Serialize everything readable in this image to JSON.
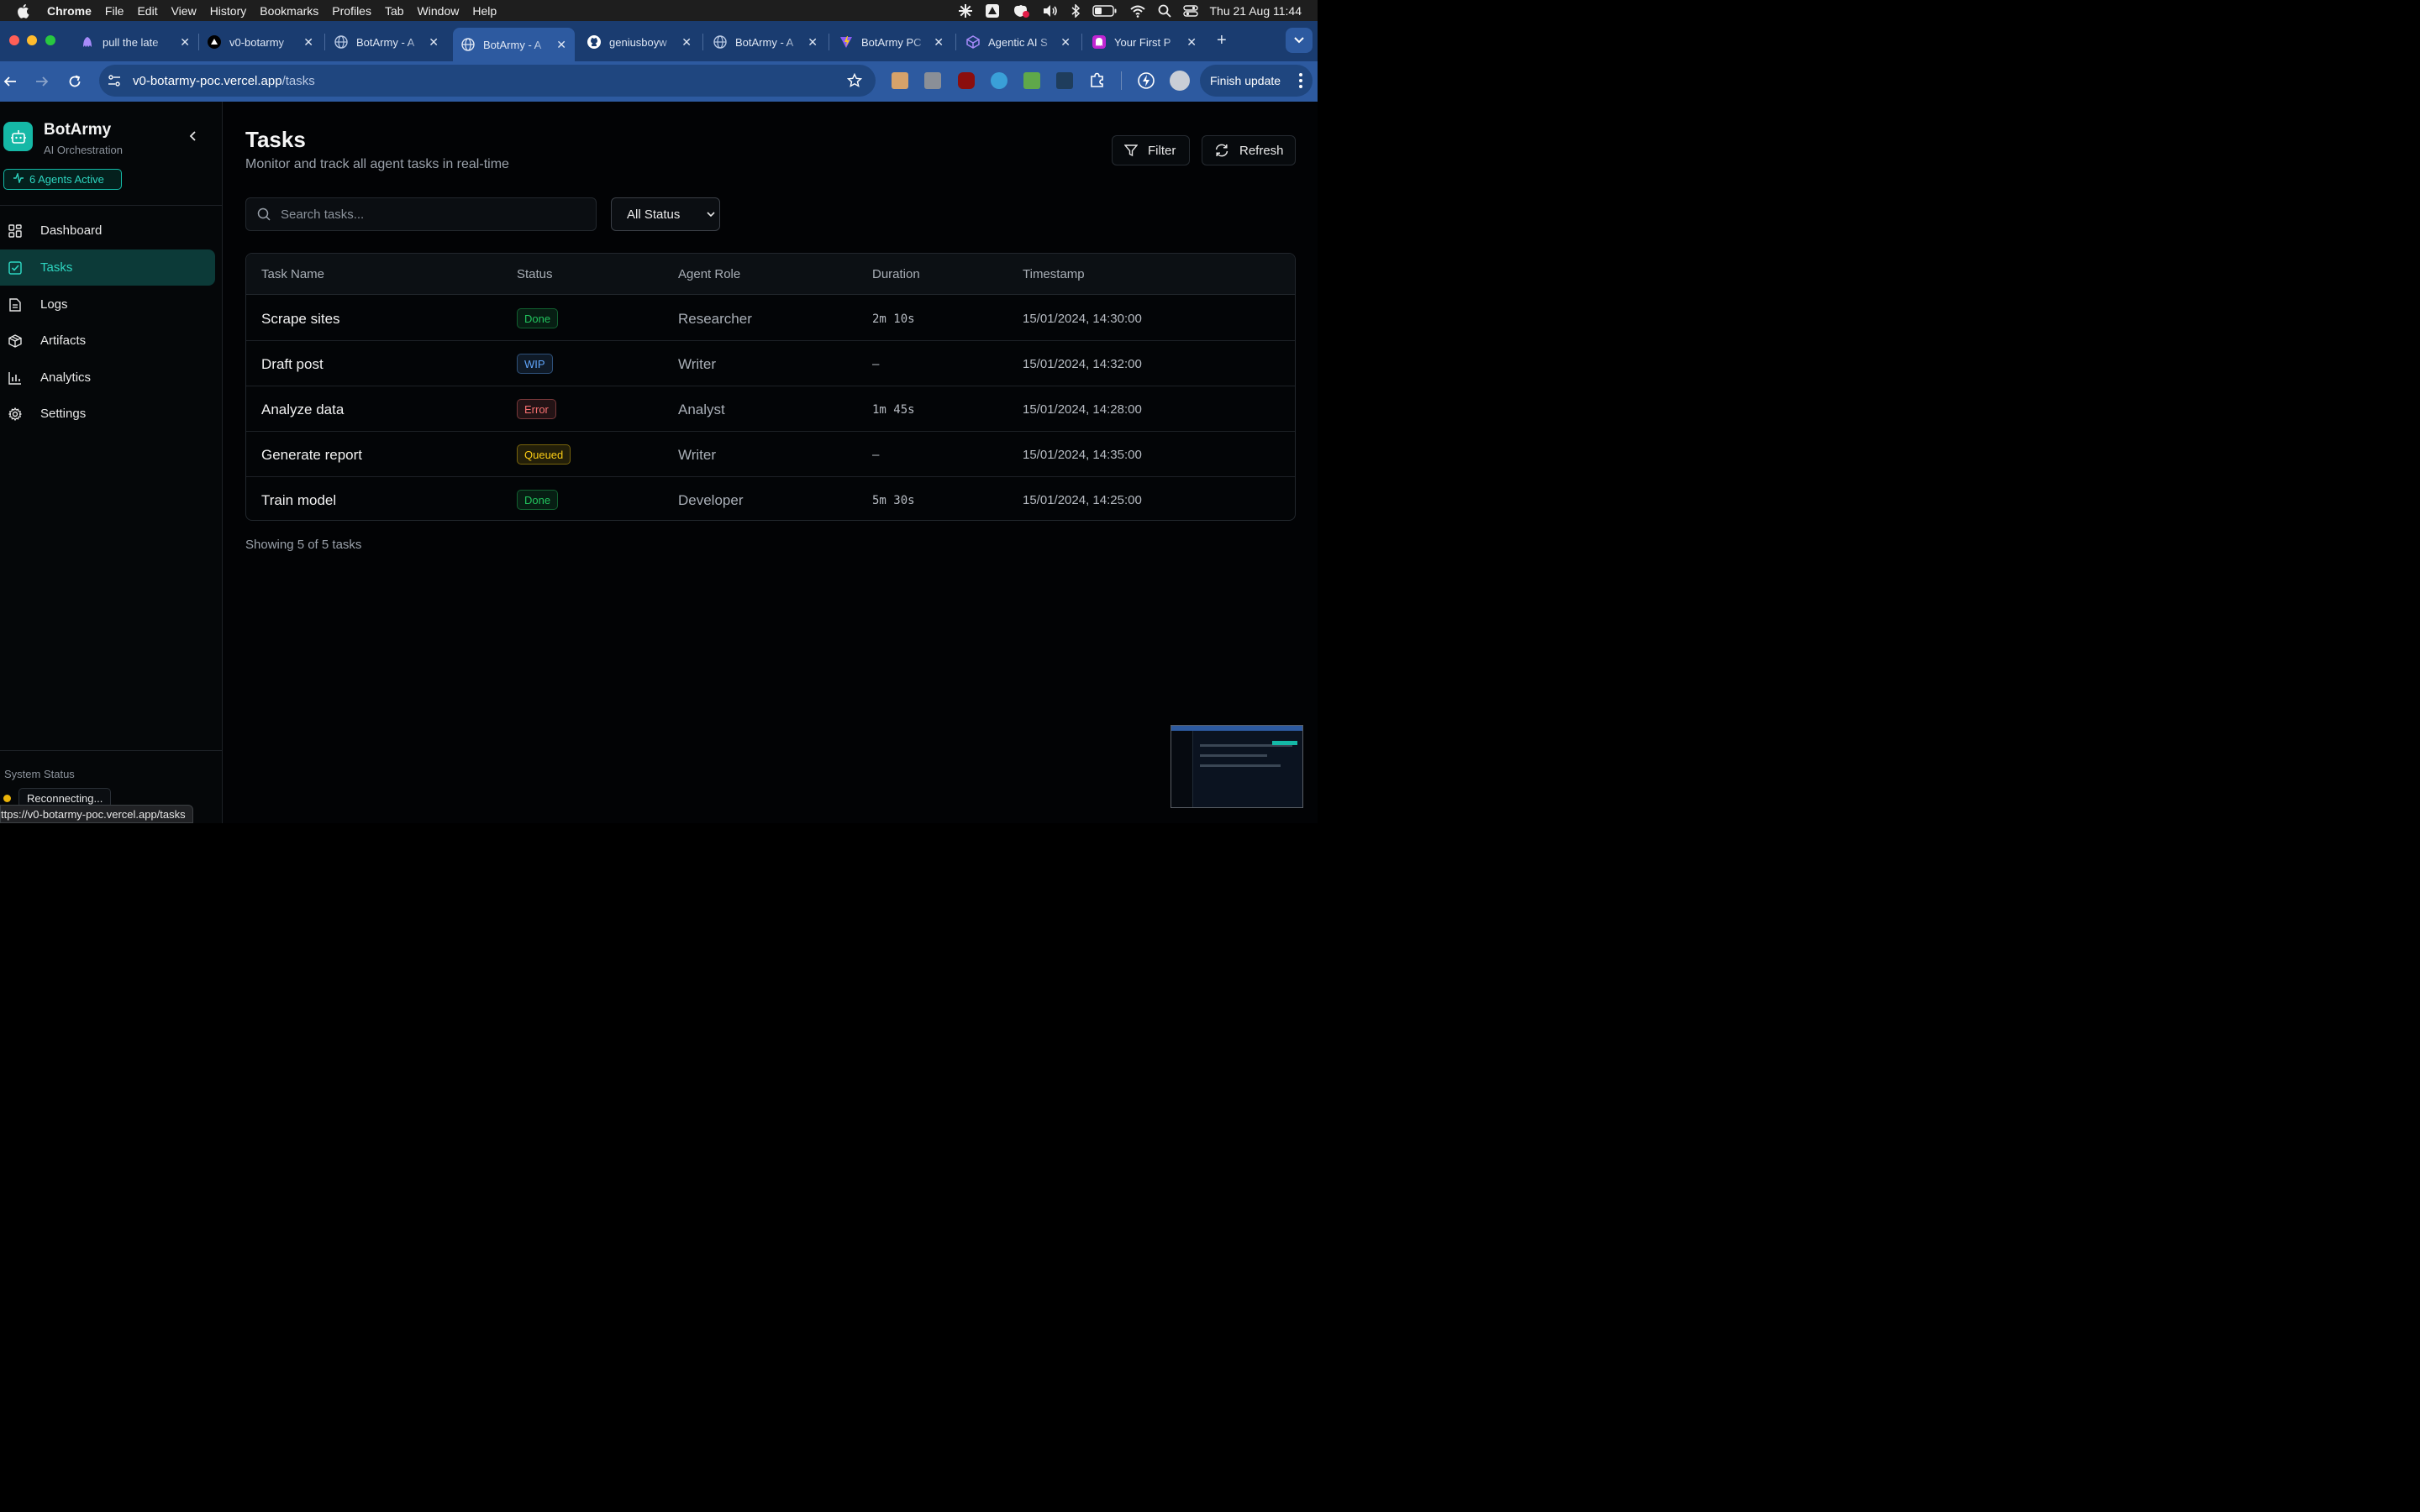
{
  "menubar": {
    "app_name": "Chrome",
    "items": [
      "File",
      "Edit",
      "View",
      "History",
      "Bookmarks",
      "Profiles",
      "Tab",
      "Window",
      "Help"
    ],
    "clock": "Thu 21 Aug  11:44"
  },
  "tabs": [
    {
      "label": "pull the late",
      "icon": "ai-assistant-icon"
    },
    {
      "label": "v0-botarmy",
      "icon": "vercel-icon"
    },
    {
      "label": "BotArmy - A",
      "icon": "globe-icon"
    },
    {
      "label": "BotArmy - A",
      "icon": "globe-icon",
      "active": true
    },
    {
      "label": "geniusboyw",
      "icon": "github-icon"
    },
    {
      "label": "BotArmy - A",
      "icon": "globe-icon"
    },
    {
      "label": "BotArmy PC",
      "icon": "vite-icon"
    },
    {
      "label": "Agentic AI S",
      "icon": "cube-icon"
    },
    {
      "label": "Your First P",
      "icon": "ghost-icon"
    }
  ],
  "toolbar": {
    "url_host": "v0-botarmy-poc.vercel.app",
    "url_path": "/tasks",
    "finish_update": "Finish update"
  },
  "sidebar": {
    "brand_title": "BotArmy",
    "brand_subtitle": "AI Orchestration",
    "agents_badge": "6 Agents Active",
    "nav": [
      {
        "label": "Dashboard",
        "icon": "grid-icon"
      },
      {
        "label": "Tasks",
        "icon": "checkbox-icon",
        "active": true
      },
      {
        "label": "Logs",
        "icon": "document-icon"
      },
      {
        "label": "Artifacts",
        "icon": "package-icon"
      },
      {
        "label": "Analytics",
        "icon": "bar-chart-icon"
      },
      {
        "label": "Settings",
        "icon": "gear-icon"
      }
    ],
    "system_status_label": "System Status",
    "system_status_value": "Reconnecting..."
  },
  "main": {
    "title": "Tasks",
    "subtitle": "Monitor and track all agent tasks in real-time",
    "filter_label": "Filter",
    "refresh_label": "Refresh",
    "search_placeholder": "Search tasks...",
    "status_filter": "All Status",
    "columns": [
      "Task Name",
      "Status",
      "Agent Role",
      "Duration",
      "Timestamp"
    ],
    "rows": [
      {
        "name": "Scrape sites",
        "status": "Done",
        "role": "Researcher",
        "duration": "2m 10s",
        "timestamp": "15/01/2024, 14:30:00"
      },
      {
        "name": "Draft post",
        "status": "WIP",
        "role": "Writer",
        "duration": "–",
        "timestamp": "15/01/2024, 14:32:00"
      },
      {
        "name": "Analyze data",
        "status": "Error",
        "role": "Analyst",
        "duration": "1m 45s",
        "timestamp": "15/01/2024, 14:28:00"
      },
      {
        "name": "Generate report",
        "status": "Queued",
        "role": "Writer",
        "duration": "–",
        "timestamp": "15/01/2024, 14:35:00"
      },
      {
        "name": "Train model",
        "status": "Done",
        "role": "Developer",
        "duration": "5m 30s",
        "timestamp": "15/01/2024, 14:25:00"
      }
    ],
    "showing": "Showing 5 of 5 tasks"
  },
  "status_colors": {
    "Done": "#22c55e",
    "WIP": "#60a5fa",
    "Error": "#f87171",
    "Queued": "#facc15"
  },
  "statusbar_url": "ttps://v0-botarmy-poc.vercel.app/tasks"
}
